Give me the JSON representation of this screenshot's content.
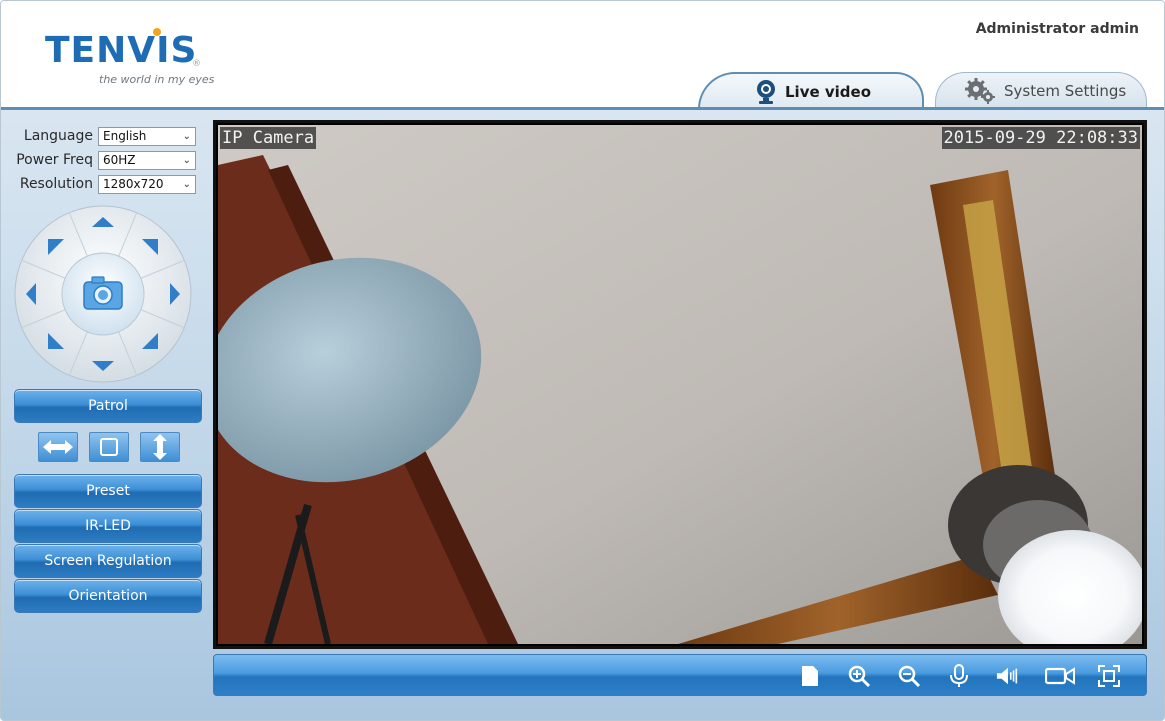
{
  "header": {
    "logo_text": "TENVIS",
    "logo_registered": "®",
    "logo_tagline": "the world in my eyes",
    "user_label": "Administrator admin"
  },
  "tabs": [
    {
      "label": "Live video",
      "icon": "webcam-icon",
      "active": true
    },
    {
      "label": "System Settings",
      "icon": "gear-icon",
      "active": false
    }
  ],
  "settings": {
    "language": {
      "label": "Language",
      "value": "English"
    },
    "power_freq": {
      "label": "Power Freq",
      "value": "60HZ"
    },
    "resolution": {
      "label": "Resolution",
      "value": "1280x720"
    }
  },
  "controls": {
    "patrol": "Patrol",
    "preset": "Preset",
    "ir_led": "IR-LED",
    "screen_regulation": "Screen Regulation",
    "orientation": "Orientation"
  },
  "video": {
    "osd_name": "IP Camera",
    "osd_timestamp": "2015-09-29 22:08:33"
  },
  "toolbar_icons": [
    "record-file-icon",
    "zoom-in-icon",
    "zoom-out-icon",
    "microphone-icon",
    "speaker-icon",
    "video-camera-icon",
    "fullscreen-icon"
  ],
  "colors": {
    "accent": "#1e6db4",
    "button": "#2d7cc2",
    "logo_dot": "#f3a41a"
  }
}
